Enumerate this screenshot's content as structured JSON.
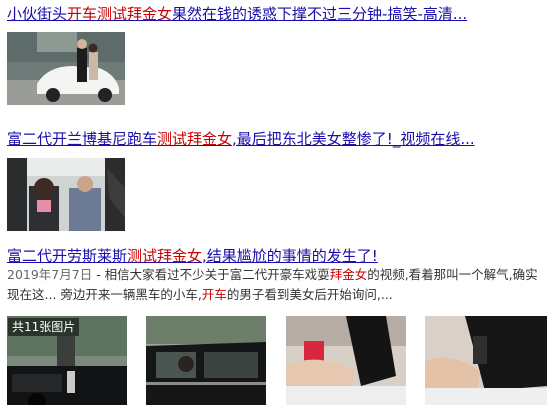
{
  "results": [
    {
      "title_parts": [
        {
          "text": "小伙街头",
          "hl": false
        },
        {
          "text": "开车",
          "hl": true
        },
        {
          "text": "测试拜金女",
          "hl": true
        },
        {
          "text": "果然在钱的诱惑下撑不过三分钟-搞笑-高清...",
          "hl": false
        }
      ]
    },
    {
      "title_parts": [
        {
          "text": "富二代开兰博基尼跑车",
          "hl": false
        },
        {
          "text": "测试拜金女",
          "hl": true
        },
        {
          "text": ",最后把东北美女整惨了!_视频在线...",
          "hl": false
        }
      ]
    },
    {
      "title_parts": [
        {
          "text": "富二代开劳斯莱斯",
          "hl": false
        },
        {
          "text": "测试拜金女",
          "hl": true
        },
        {
          "text": ",结果尴尬的事情的发生了!",
          "hl": false
        }
      ],
      "date": "2019年7月7日",
      "snippet_parts": [
        {
          "text": " - 相信大家看过不少关于富二代开豪车戏耍",
          "hl": false
        },
        {
          "text": "拜金女",
          "hl": true
        },
        {
          "text": "的视频,看着那叫一个解气,确实现在这... 旁边开来一辆黑车的小车,",
          "hl": false
        },
        {
          "text": "开车",
          "hl": true
        },
        {
          "text": "的男子看到美女后开始询问,...",
          "hl": false
        }
      ],
      "gallery_badge": "共11张图片"
    }
  ],
  "colors": {
    "link": "#1a0dab",
    "highlight": "#cc0000"
  }
}
